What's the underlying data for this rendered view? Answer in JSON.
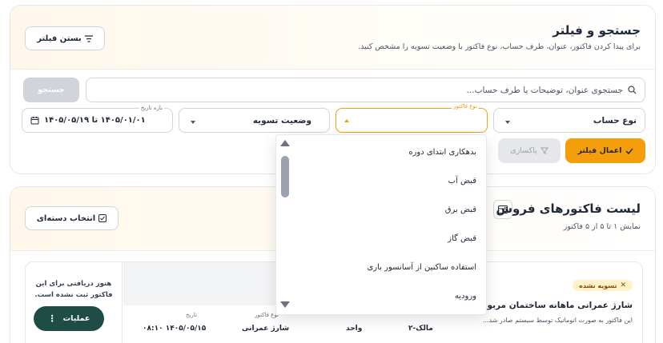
{
  "filter": {
    "title": "جستجو و فیلتر",
    "subtitle": "برای پیدا کردن فاکتور، عنوان، طرف حساب، نوع فاکتور یا وضعیت تسویه را مشخص کنید.",
    "close_label": "بستن فیلتر",
    "search_placeholder": "جستجوی عنوان، توضیحات یا طرف حساب...",
    "search_button": "جستجو",
    "account_type": "نوع حساب",
    "invoice_type_label": "نوع فاکتور",
    "settlement_status": "وضعیت تسویه",
    "date_label": "بازه تاریخ",
    "date_value": "۱۴۰۵/۰۱/۰۱ تا ۱۴۰۵/۰۵/۱۹",
    "apply_label": "اعمال فیلتر",
    "clear_label": "پاکسازی"
  },
  "dropdown": {
    "options": [
      "بدهکاری ابتدای دوره",
      "قبض آب",
      "قبض برق",
      "قبض گاز",
      "استفاده ساکنین از آسانسور باری",
      "ورودیه"
    ]
  },
  "list": {
    "title": "لیست فاکتورهای فروش",
    "subtitle": "نمایش ۱ تا ۵ از ۵ فاکتور",
    "select_label": "انتخاب دسته‌ای"
  },
  "invoice": {
    "status": "تسویه نشده",
    "title": "شارژ عمرانی ماهانه ساختمان مربوط به",
    "desc": "این فاکتور به صورت اتوماتیک توسط سیستم صادر شد...",
    "col_unit": "مالک-۲",
    "col_owner": "واحد",
    "col_type_label": "نوع فاکتور",
    "col_type": "شارژ عمرانی",
    "col_date_label": "تاریخ",
    "col_date": "۱۴۰۵/۰۵/۱۵ ۰۸:۱۰",
    "no_receipt": "هنوز دریافتی برای این فاکتور ثبت نشده است.",
    "operations": "عملیات"
  },
  "colors": {
    "accent": "#f59e0b",
    "primary_dark": "#1f4d45",
    "muted": "#9ca3af"
  }
}
